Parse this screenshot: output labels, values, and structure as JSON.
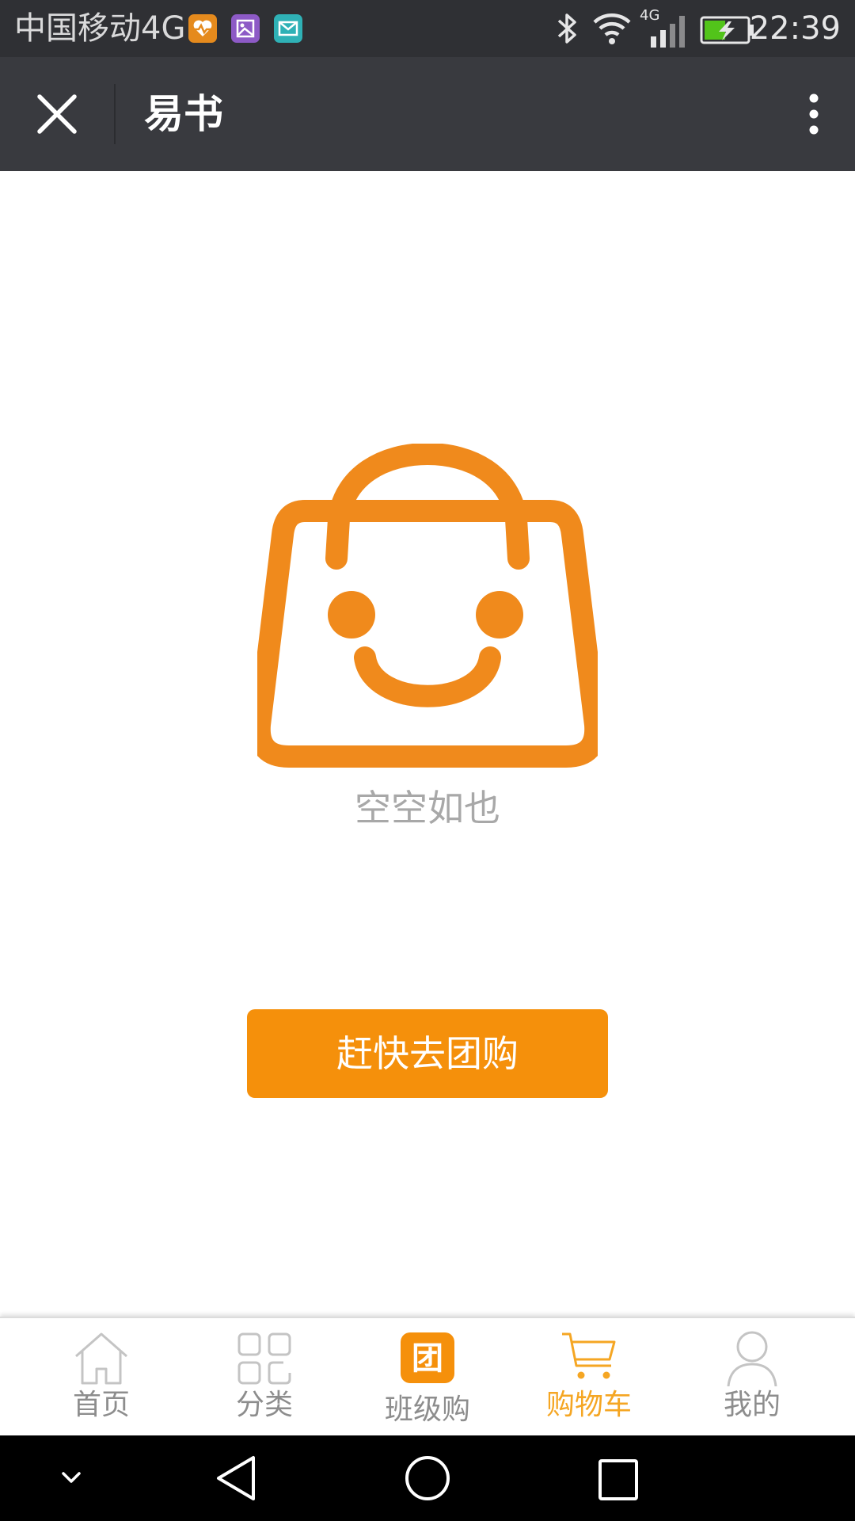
{
  "status_bar": {
    "carrier": "中国移动4G",
    "network_type": "4G",
    "time": "22:39",
    "notification_icons": [
      "health-app-icon",
      "gallery-app-icon",
      "mail-app-icon"
    ],
    "system_icons": [
      "bluetooth-icon",
      "wifi-icon",
      "cellular-signal-icon",
      "battery-charging-icon"
    ]
  },
  "title_bar": {
    "title": "易书",
    "close_icon": "close-icon",
    "more_icon": "more-vertical-icon"
  },
  "empty_state": {
    "icon": "smiling-shopping-bag-icon",
    "message": "空空如也",
    "button_label": "赶快去团购"
  },
  "tab_bar": {
    "tabs": [
      {
        "label": "首页",
        "icon": "home-icon",
        "active": false
      },
      {
        "label": "分类",
        "icon": "category-grid-icon",
        "active": false
      },
      {
        "label": "班级购",
        "icon": "group-buy-icon",
        "badge_char": "团",
        "active": false
      },
      {
        "label": "购物车",
        "icon": "shopping-cart-icon",
        "active": true
      },
      {
        "label": "我的",
        "icon": "user-icon",
        "active": false
      }
    ]
  },
  "nav_bar": {
    "buttons": [
      "hide-nav-icon",
      "back-icon",
      "home-circle-icon",
      "recent-apps-icon"
    ]
  },
  "colors": {
    "accent": "#f5900b",
    "active_tab": "#f5a623",
    "title_bar": "#393a3f",
    "status_bar": "#2f3034",
    "muted_text": "#a8a8a8"
  }
}
